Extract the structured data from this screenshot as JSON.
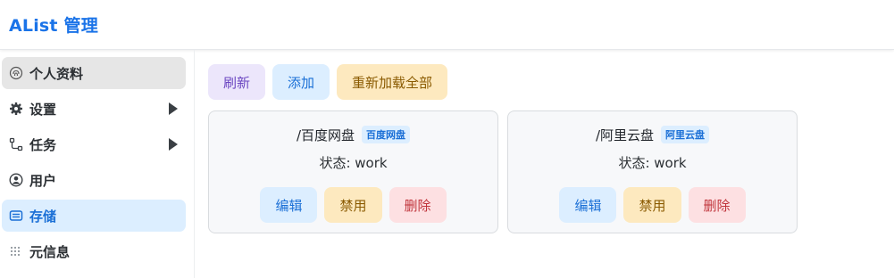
{
  "header": {
    "title": "AList 管理"
  },
  "sidebar": {
    "items": [
      {
        "label": "个人资料",
        "icon": "fingerprint-icon"
      },
      {
        "label": "设置",
        "icon": "gear-icon"
      },
      {
        "label": "任务",
        "icon": "flow-icon"
      },
      {
        "label": "用户",
        "icon": "user-circle-icon"
      },
      {
        "label": "存储",
        "icon": "storage-icon"
      },
      {
        "label": "元信息",
        "icon": "grid-icon"
      }
    ]
  },
  "toolbar": {
    "refresh_label": "刷新",
    "add_label": "添加",
    "reload_all_label": "重新加载全部"
  },
  "storages": [
    {
      "path": "/百度网盘",
      "driver": "百度网盘",
      "status": "状态: work",
      "edit": "编辑",
      "disable": "禁用",
      "delete": "删除"
    },
    {
      "path": "/阿里云盘",
      "driver": "阿里云盘",
      "status": "状态: work",
      "edit": "编辑",
      "disable": "禁用",
      "delete": "删除"
    }
  ],
  "colors": {
    "accent": "#1a73e8",
    "active_bg": "#dceeff"
  }
}
